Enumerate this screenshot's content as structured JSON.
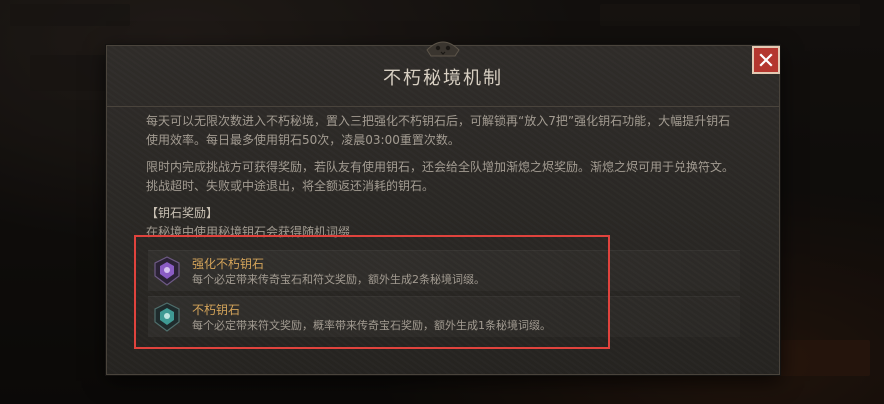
{
  "dialog": {
    "title": "不朽秘境机制",
    "paragraphs": [
      "每天可以无限次数进入不朽秘境，置入三把强化不朽钥石后，可解锁再“放入7把”强化钥石功能，大幅提升钥石使用效率。每日最多使用钥石50次，凌晨03:00重置次数。",
      "限时内完成挑战方可获得奖励，若队友有使用钥石，还会给全队增加渐熄之烬奖励。渐熄之烬可用于兑换符文。挑战超时、失败或中途退出，将全额返还消耗的钥石。"
    ],
    "reward_heading": "【钥石奖励】",
    "reward_subheading": "在秘境中使用秘境钥石会获得随机词缀",
    "items": [
      {
        "name": "强化不朽钥石",
        "desc": "每个必定带来传奇宝石和符文奖励，额外生成2条秘境词缀。",
        "icon": "purple-keystone-icon",
        "icon_color": "#8a5cc4"
      },
      {
        "name": "不朽钥石",
        "desc": "每个必定带来符文奖励，概率带来传奇宝石奖励，额外生成1条秘境词缀。",
        "icon": "teal-keystone-icon",
        "icon_color": "#3f9a94"
      }
    ]
  },
  "colors": {
    "close_button": "#b4372f",
    "highlight_border": "#e0433d",
    "item_name": "#d4a45a"
  }
}
